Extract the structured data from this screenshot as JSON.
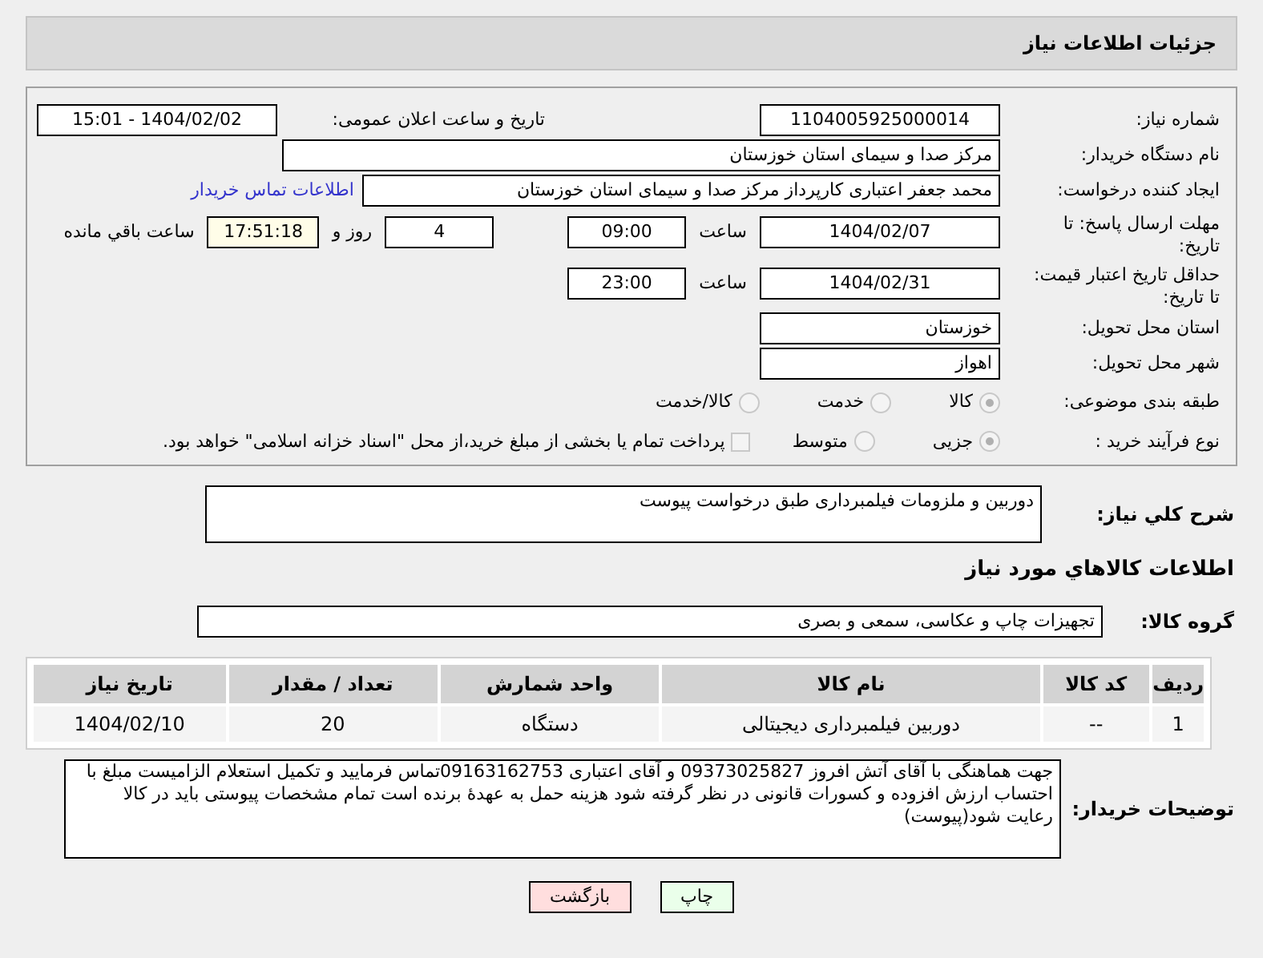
{
  "header": {
    "title": "جزئیات اطلاعات نیاز"
  },
  "need_number": {
    "label": "شماره نیاز:",
    "value": "1104005925000014"
  },
  "announce": {
    "label": "تاریخ و ساعت اعلان عمومی:",
    "value": "1404/02/02 - 15:01"
  },
  "buyer_org": {
    "label": "نام دستگاه خریدار:",
    "value": "مرکز صدا و سیمای استان خوزستان"
  },
  "creator": {
    "label": "ایجاد کننده درخواست:",
    "value": "محمد جعفر اعتباری کارپرداز مرکز صدا و سیمای استان خوزستان",
    "link": "اطلاعات تماس خریدار"
  },
  "deadline": {
    "label": "مهلت ارسال پاسخ: تا تاریخ:",
    "date": "1404/02/07",
    "time_label": "ساعت",
    "time": "09:00",
    "days": "4",
    "days_label": "روز و",
    "remaining": "17:51:18",
    "remaining_label": "ساعت باقي مانده"
  },
  "validity": {
    "label": "حداقل تاریخ اعتبار قیمت: تا تاریخ:",
    "date": "1404/02/31",
    "time_label": "ساعت",
    "time": "23:00"
  },
  "province": {
    "label": "استان محل تحویل:",
    "value": "خوزستان"
  },
  "city": {
    "label": "شهر محل تحویل:",
    "value": "اهواز"
  },
  "category": {
    "label": "طبقه بندی موضوعی:",
    "options": [
      {
        "label": "کالا",
        "selected": true
      },
      {
        "label": "خدمت",
        "selected": false
      },
      {
        "label": "کالا/خدمت",
        "selected": false
      }
    ]
  },
  "process": {
    "label": "نوع فرآیند خرید :",
    "options": [
      {
        "label": "جزیی",
        "selected": true
      },
      {
        "label": "متوسط",
        "selected": false
      }
    ],
    "payment": {
      "checked": false,
      "text": "پرداخت تمام یا بخشی از مبلغ خرید،از محل \"اسناد خزانه اسلامی\" خواهد بود."
    }
  },
  "description": {
    "label": "شرح کلي نياز:",
    "value": "دوربین و ملزومات فیلمبرداری طبق درخواست پیوست"
  },
  "goods_title": "اطلاعات کالاهاي مورد نياز",
  "goods_group": {
    "label": "گروه کالا:",
    "value": "تجهیزات چاپ و عکاسی، سمعی و بصری"
  },
  "table": {
    "columns": [
      "رديف",
      "کد کالا",
      "نام کالا",
      "واحد شمارش",
      "تعداد / مقدار",
      "تاریخ نیاز"
    ],
    "rows": [
      [
        "1",
        "--",
        "دوربین فیلمبرداری دیجیتالی",
        "دستگاه",
        "20",
        "1404/02/10"
      ]
    ]
  },
  "buyer_notes": {
    "label": "توضیحات خریدار:",
    "value": "جهت هماهنگی با آقای آتش افروز 09373025827 و آقای اعتباری 09163162753تماس فرمایید و تکمیل استعلام الزامیست مبلغ با احتساب ارزش افزوده و کسورات قانونی در نظر گرفته شود هزینه حمل به عهدهٔ برنده است تمام مشخصات پیوستی باید در کالا رعایت شود(پیوست)"
  },
  "buttons": [
    {
      "label": "چاپ",
      "kind": "print"
    },
    {
      "label": "بازگشت",
      "kind": "back"
    }
  ]
}
